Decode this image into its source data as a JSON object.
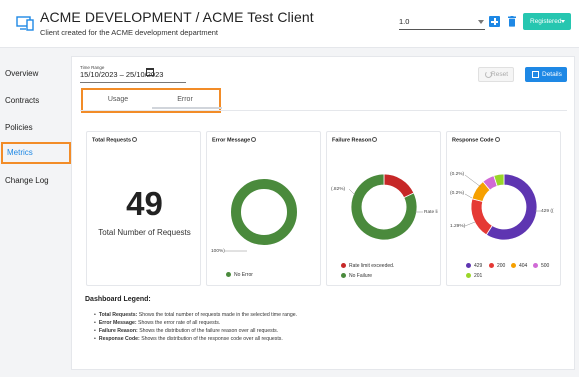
{
  "header": {
    "title": "ACME DEVELOPMENT / ACME Test Client",
    "subtitle": "Client created for the ACME development department",
    "version_value": "1.0",
    "status_label": "Registered"
  },
  "sidebar": {
    "items": [
      {
        "label": "Overview"
      },
      {
        "label": "Contracts"
      },
      {
        "label": "Policies"
      },
      {
        "label": "Metrics"
      },
      {
        "label": "Change Log"
      }
    ],
    "active": "Metrics"
  },
  "filters": {
    "time_label": "Time Range",
    "time_value": "15/10/2023 – 25/10/2023",
    "reset_label": "Reset",
    "details_label": "Details"
  },
  "tabs": [
    {
      "label": "Usage"
    },
    {
      "label": "Error"
    }
  ],
  "cards": {
    "total": {
      "title": "Total Requests",
      "value": "49",
      "caption": "Total Number of Requests"
    },
    "error_message": {
      "title": "Error Message",
      "slice_label": "100%)",
      "legend": "No Error"
    },
    "failure_reason": {
      "title": "Failure Reason",
      "left_label": "(.82%)",
      "right_label": "Rate li",
      "legend": [
        "Rate limit exceeded.",
        "No Failure"
      ]
    },
    "response_code": {
      "title": "Response Code",
      "labels": [
        "(0.2%)",
        "(0.2%)",
        "1.29%)",
        "429 (("
      ],
      "legend": [
        "429",
        "200",
        "404",
        "500",
        "201"
      ]
    }
  },
  "chart_data": [
    {
      "type": "pie",
      "title": "Error Message",
      "categories": [
        "No Error"
      ],
      "values": [
        100
      ],
      "colors": [
        "#4a8a3c"
      ]
    },
    {
      "type": "pie",
      "title": "Failure Reason",
      "categories": [
        "Rate limit exceeded.",
        "No Failure"
      ],
      "values": [
        18,
        82
      ],
      "colors": [
        "#c62828",
        "#4a8a3c"
      ]
    },
    {
      "type": "pie",
      "title": "Response Code",
      "categories": [
        "429",
        "200",
        "404",
        "500",
        "201"
      ],
      "values": [
        59,
        20,
        10,
        6,
        5
      ],
      "colors": [
        "#5e35b1",
        "#e53935",
        "#f6a000",
        "#d06ad6",
        "#9ad629"
      ]
    }
  ],
  "dashboard_legend": {
    "title": "Dashboard Legend:",
    "items": [
      {
        "term": "Total Requests:",
        "text": " Shows the total number of requests made in the selected time range."
      },
      {
        "term": "Error Message:",
        "text": " Shows the error rate of all requests."
      },
      {
        "term": "Failure Reason:",
        "text": " Shows the distribution of the failure reason over all requests."
      },
      {
        "term": "Response Code:",
        "text": " Shows the distribution of the response code over all requests."
      }
    ]
  },
  "colors": {
    "accent": "#1e88e5",
    "highlight": "#f28c28",
    "status": "#26c6b0"
  }
}
